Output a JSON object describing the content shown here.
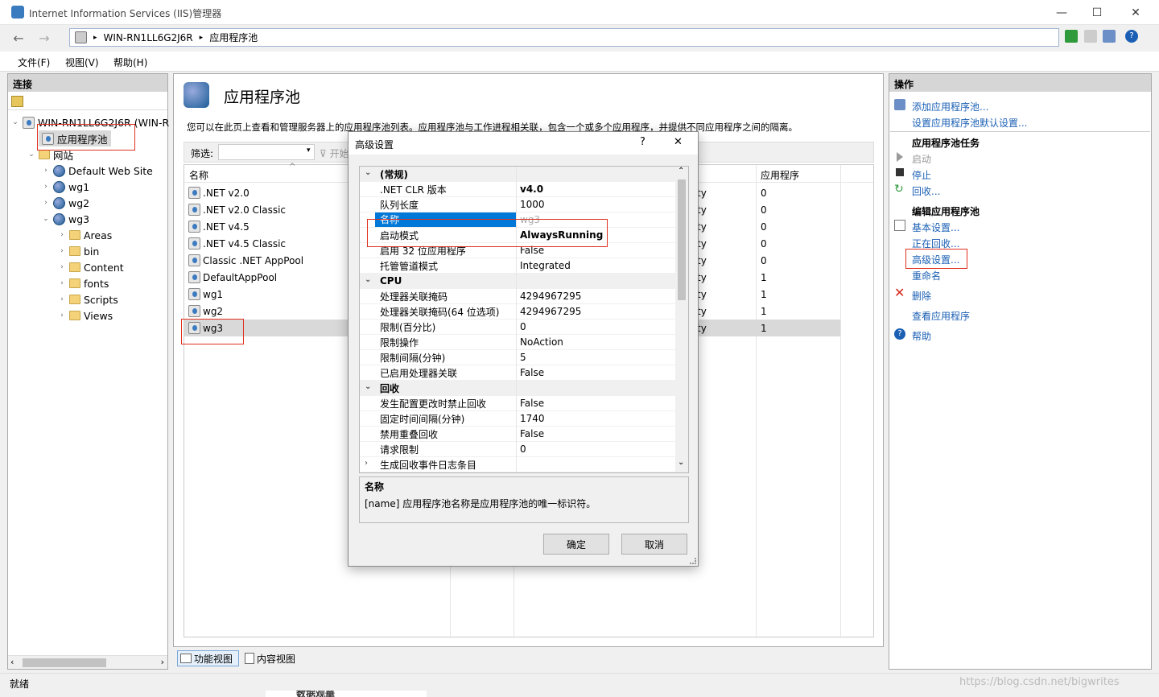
{
  "window": {
    "title": "Internet Information Services (IIS)管理器",
    "minimize": "—",
    "maximize": "☐",
    "close": "✕"
  },
  "address": {
    "segments": [
      "WIN-RN1LL6G2J6R",
      "应用程序池"
    ],
    "sep": "▸"
  },
  "menu": {
    "file": "文件(F)",
    "view": "视图(V)",
    "help": "帮助(H)"
  },
  "connections": {
    "header": "连接",
    "server": "WIN-RN1LL6G2J6R (WIN-R",
    "apppools": "应用程序池",
    "sites": "网站",
    "site_items": [
      "Default Web Site",
      "wg1",
      "wg2",
      "wg3"
    ],
    "wg3_children": [
      "Areas",
      "bin",
      "Content",
      "fonts",
      "Scripts",
      "Views"
    ]
  },
  "main": {
    "title": "应用程序池",
    "description": "您可以在此页上查看和管理服务器上的应用程序池列表。应用程序池与工作进程相关联，包含一个或多个应用程序，并提供不同应用程序之间的隔离。",
    "filter_label": "筛选:",
    "start_label": "开始",
    "col_name": "名称",
    "col_apps": "应用程序",
    "rows": [
      {
        "name": ".NET v2.0",
        "identity": "ty",
        "apps": "0"
      },
      {
        "name": ".NET v2.0 Classic",
        "identity": "ty",
        "apps": "0"
      },
      {
        "name": ".NET v4.5",
        "identity": "ty",
        "apps": "0"
      },
      {
        "name": ".NET v4.5 Classic",
        "identity": "ty",
        "apps": "0"
      },
      {
        "name": "Classic .NET AppPool",
        "identity": "ty",
        "apps": "0"
      },
      {
        "name": "DefaultAppPool",
        "identity": "ty",
        "apps": "1"
      },
      {
        "name": "wg1",
        "identity": "ty",
        "apps": "1"
      },
      {
        "name": "wg2",
        "identity": "ty",
        "apps": "1"
      },
      {
        "name": "wg3",
        "identity": "ty",
        "apps": "1"
      }
    ],
    "view_features": "功能视图",
    "view_content": "内容视图"
  },
  "dialog": {
    "title": "高级设置",
    "help": "?",
    "close": "✕",
    "rows": [
      {
        "cat": true,
        "name": "(常规)"
      },
      {
        "name": ".NET CLR 版本",
        "value": "v4.0",
        "bold": true
      },
      {
        "name": "队列长度",
        "value": "1000"
      },
      {
        "name": "名称",
        "value": "wg3",
        "selected": true
      },
      {
        "name": "启动模式",
        "value": "AlwaysRunning",
        "bold": true
      },
      {
        "name": "启用 32 位应用程序",
        "value": "False"
      },
      {
        "name": "托管管道模式",
        "value": "Integrated"
      },
      {
        "cat": true,
        "name": "CPU"
      },
      {
        "name": "处理器关联掩码",
        "value": "4294967295"
      },
      {
        "name": "处理器关联掩码(64 位选项)",
        "value": "4294967295"
      },
      {
        "name": "限制(百分比)",
        "value": "0"
      },
      {
        "name": "限制操作",
        "value": "NoAction"
      },
      {
        "name": "限制间隔(分钟)",
        "value": "5"
      },
      {
        "name": "已启用处理器关联",
        "value": "False"
      },
      {
        "cat": true,
        "name": "回收"
      },
      {
        "name": "发生配置更改时禁止回收",
        "value": "False"
      },
      {
        "name": "固定时间间隔(分钟)",
        "value": "1740"
      },
      {
        "name": "禁用重叠回收",
        "value": "False"
      },
      {
        "name": "请求限制",
        "value": "0"
      },
      {
        "name": "生成回收事件日志条目",
        "value": "",
        "collapsed": true
      }
    ],
    "desc_title": "名称",
    "desc_text": "[name] 应用程序池名称是应用程序池的唯一标识符。",
    "ok": "确定",
    "cancel": "取消"
  },
  "actions": {
    "header": "操作",
    "add_pool": "添加应用程序池...",
    "set_defaults": "设置应用程序池默认设置...",
    "tasks_header": "应用程序池任务",
    "start": "启动",
    "stop": "停止",
    "recycle": "回收...",
    "edit_header": "编辑应用程序池",
    "basic": "基本设置...",
    "recycling": "正在回收...",
    "advanced": "高级设置...",
    "rename": "重命名",
    "delete": "删除",
    "view_apps": "查看应用程序",
    "help": "帮助"
  },
  "status": {
    "text": "就绪",
    "watermark": "https://blog.csdn.net/bigwrites",
    "behind": "数据观華"
  }
}
